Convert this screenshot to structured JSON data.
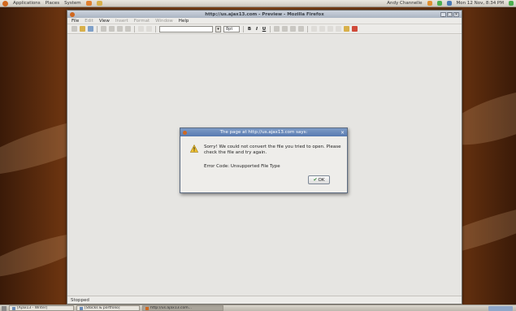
{
  "top_panel": {
    "menus": [
      "Applications",
      "Places",
      "System"
    ],
    "user": "Andy Channelle",
    "clock": "Mon 12 Nov, 8:34 PM"
  },
  "window": {
    "title": "http://us.ajax13.com - Preview - Mozilla Firefox",
    "controls": [
      "_",
      "□",
      "×"
    ]
  },
  "menubar": {
    "items": [
      {
        "label": "File",
        "enabled": true
      },
      {
        "label": "Edit",
        "enabled": false
      },
      {
        "label": "View",
        "enabled": true
      },
      {
        "label": "Insert",
        "enabled": false
      },
      {
        "label": "Format",
        "enabled": false
      },
      {
        "label": "Window",
        "enabled": false
      },
      {
        "label": "Help",
        "enabled": true
      }
    ]
  },
  "toolbar": {
    "font_size": "8pt",
    "bold": "B",
    "italic": "I",
    "underline": "U"
  },
  "dialog": {
    "title": "The page at http://us.ajax13.com says:",
    "message": "Sorry! We could not convert the file you tried to open. Please check the file and try again.",
    "error": "Error Code: Unsupported File Type",
    "ok_label": "OK"
  },
  "status": {
    "text": "Stopped"
  },
  "taskbar": {
    "tasks": [
      {
        "label": "[Ajax13 - Writer]",
        "active": false
      },
      {
        "label": "[Stocks & portfolio]",
        "active": false
      },
      {
        "label": "http://us.ajax13.com...",
        "active": true
      }
    ]
  }
}
